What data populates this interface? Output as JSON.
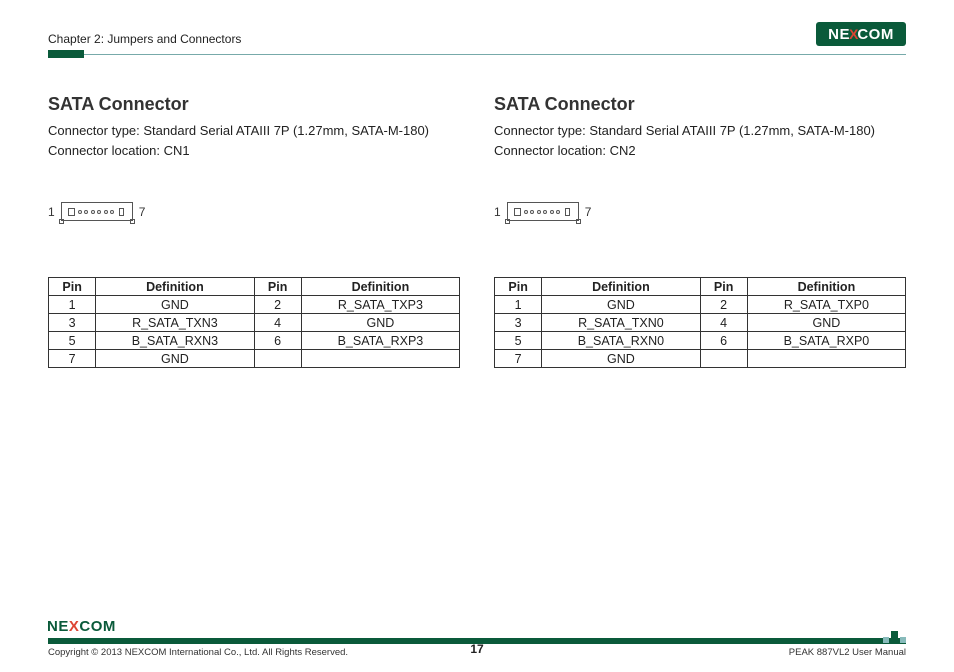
{
  "header": {
    "chapter": "Chapter 2: Jumpers and Connectors",
    "logo_ne": "NE",
    "logo_x": "X",
    "logo_com": "COM"
  },
  "sections": [
    {
      "title": "SATA Connector",
      "type_label": "Connector type: Standard Serial ATAIII 7P (1.27mm, SATA-M-180)",
      "location_label": "Connector location: CN1",
      "pin_left": "1",
      "pin_right": "7",
      "headers": {
        "pin": "Pin",
        "def": "Definition"
      },
      "rows": [
        {
          "p1": "1",
          "d1": "GND",
          "p2": "2",
          "d2": "R_SATA_TXP3"
        },
        {
          "p1": "3",
          "d1": "R_SATA_TXN3",
          "p2": "4",
          "d2": "GND"
        },
        {
          "p1": "5",
          "d1": "B_SATA_RXN3",
          "p2": "6",
          "d2": "B_SATA_RXP3"
        },
        {
          "p1": "7",
          "d1": "GND",
          "p2": "",
          "d2": ""
        }
      ]
    },
    {
      "title": "SATA Connector",
      "type_label": "Connector type: Standard Serial ATAIII 7P (1.27mm, SATA-M-180)",
      "location_label": "Connector location: CN2",
      "pin_left": "1",
      "pin_right": "7",
      "headers": {
        "pin": "Pin",
        "def": "Definition"
      },
      "rows": [
        {
          "p1": "1",
          "d1": "GND",
          "p2": "2",
          "d2": "R_SATA_TXP0"
        },
        {
          "p1": "3",
          "d1": "R_SATA_TXN0",
          "p2": "4",
          "d2": "GND"
        },
        {
          "p1": "5",
          "d1": "B_SATA_RXN0",
          "p2": "6",
          "d2": "B_SATA_RXP0"
        },
        {
          "p1": "7",
          "d1": "GND",
          "p2": "",
          "d2": ""
        }
      ]
    }
  ],
  "footer": {
    "logo_ne": "NE",
    "logo_x": "X",
    "logo_com": "COM",
    "copyright": "Copyright © 2013 NEXCOM International Co., Ltd. All Rights Reserved.",
    "page_number": "17",
    "manual": "PEAK 887VL2 User Manual"
  }
}
